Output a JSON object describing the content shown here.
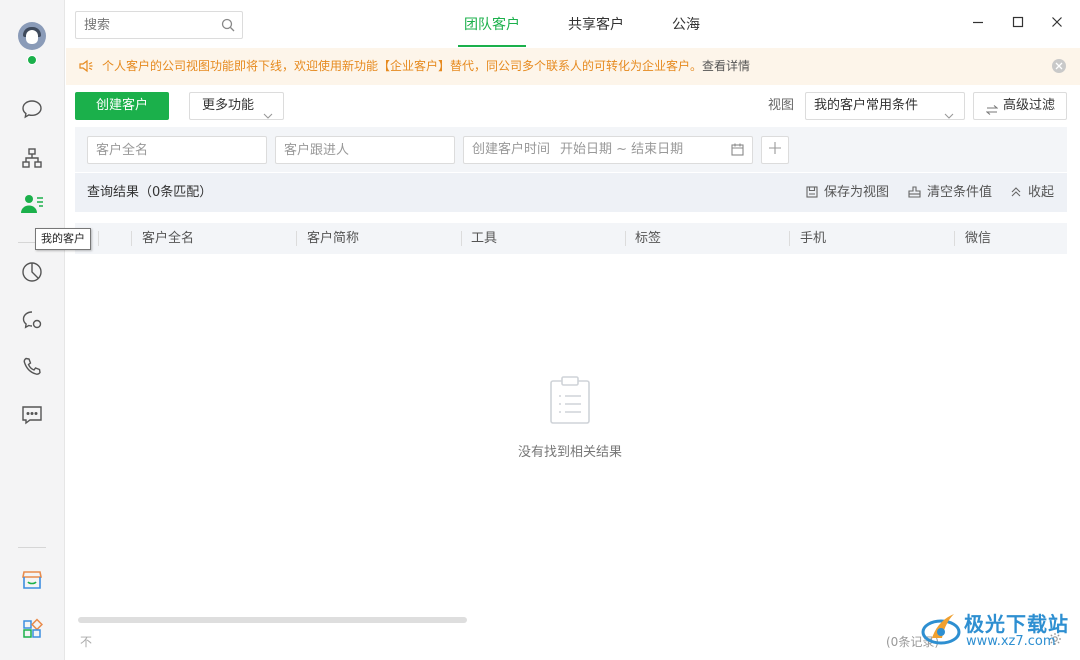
{
  "search": {
    "placeholder": "搜索"
  },
  "tabs": [
    {
      "label": "团队客户",
      "active": true
    },
    {
      "label": "共享客户",
      "active": false
    },
    {
      "label": "公海",
      "active": false
    }
  ],
  "window_controls": [
    "minimize-icon",
    "maximize-icon",
    "close-icon"
  ],
  "sidebar": {
    "items": [
      {
        "icon": "chat-bubble-icon"
      },
      {
        "icon": "org-chart-icon"
      },
      {
        "icon": "customer-icon",
        "active": true
      },
      {
        "icon": "pie-chart-icon"
      },
      {
        "icon": "moments-icon"
      },
      {
        "icon": "phone-icon"
      },
      {
        "icon": "message-icon"
      }
    ],
    "bottom_items": [
      {
        "icon": "store-icon"
      },
      {
        "icon": "apps-grid-icon"
      }
    ],
    "tooltip": "我的客户"
  },
  "notice": {
    "text": "个人客户的公司视图功能即将下线，欢迎使用新功能【企业客户】替代，同公司多个联系人的可转化为企业客户。",
    "link": "查看详情"
  },
  "toolbar": {
    "create_label": "创建客户",
    "more_label": "更多功能",
    "view_label": "视图",
    "view_value": "我的客户常用条件",
    "filter_label": "高级过滤"
  },
  "filters": {
    "full_name_placeholder": "客户全名",
    "follower_placeholder": "客户跟进人",
    "date_label": "创建客户时间",
    "date_range": "开始日期 ~ 结束日期"
  },
  "result": {
    "title": "查询结果（0条匹配）",
    "save_view": "保存为视图",
    "clear": "清空条件值",
    "collapse": "收起"
  },
  "table": {
    "columns": [
      "客户全名",
      "客户简称",
      "工具",
      "标签",
      "手机",
      "微信"
    ],
    "empty_text": "没有找到相关结果"
  },
  "footer": {
    "left_text": "不",
    "count_text": "(0条记录)"
  },
  "watermark": {
    "title": "极光下载站",
    "url": "www.xz7.com"
  },
  "colors": {
    "accent": "#1bb04b",
    "notice_text": "#e68a1f",
    "notice_bg": "#fdf5ea"
  }
}
